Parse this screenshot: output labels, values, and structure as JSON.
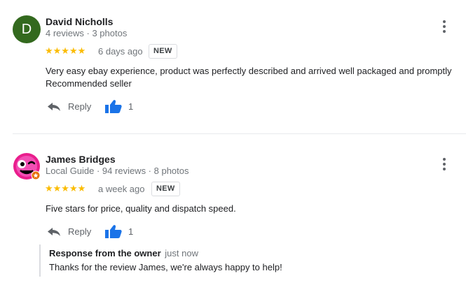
{
  "reviews": [
    {
      "avatar_letter": "D",
      "avatar_color": "#33691e",
      "name": "David Nicholls",
      "meta": "4 reviews · 3 photos",
      "stars": "★★★★★",
      "rating": 5,
      "date": "6 days ago",
      "badge": "NEW",
      "text_line1": "Very easy ebay experience, product was  perfectly described and arrived well packaged and promptly",
      "text_line2": "Recommended seller",
      "reply_label": "Reply",
      "like_count": "1"
    },
    {
      "avatar_icon": "winking-pink-face-icon",
      "name": "James Bridges",
      "meta": "Local Guide · 94 reviews · 8 photos",
      "stars": "★★★★★",
      "rating": 5,
      "date": "a week ago",
      "badge": "NEW",
      "text": "Five stars for price, quality and dispatch speed.",
      "reply_label": "Reply",
      "like_count": "1",
      "owner_response": {
        "title": "Response from the owner",
        "time": "just now",
        "text": "Thanks for the review James, we're always happy to help!"
      }
    }
  ],
  "colors": {
    "star": "#fbbc04",
    "like_blue": "#1a73e8",
    "muted": "#70757a"
  }
}
